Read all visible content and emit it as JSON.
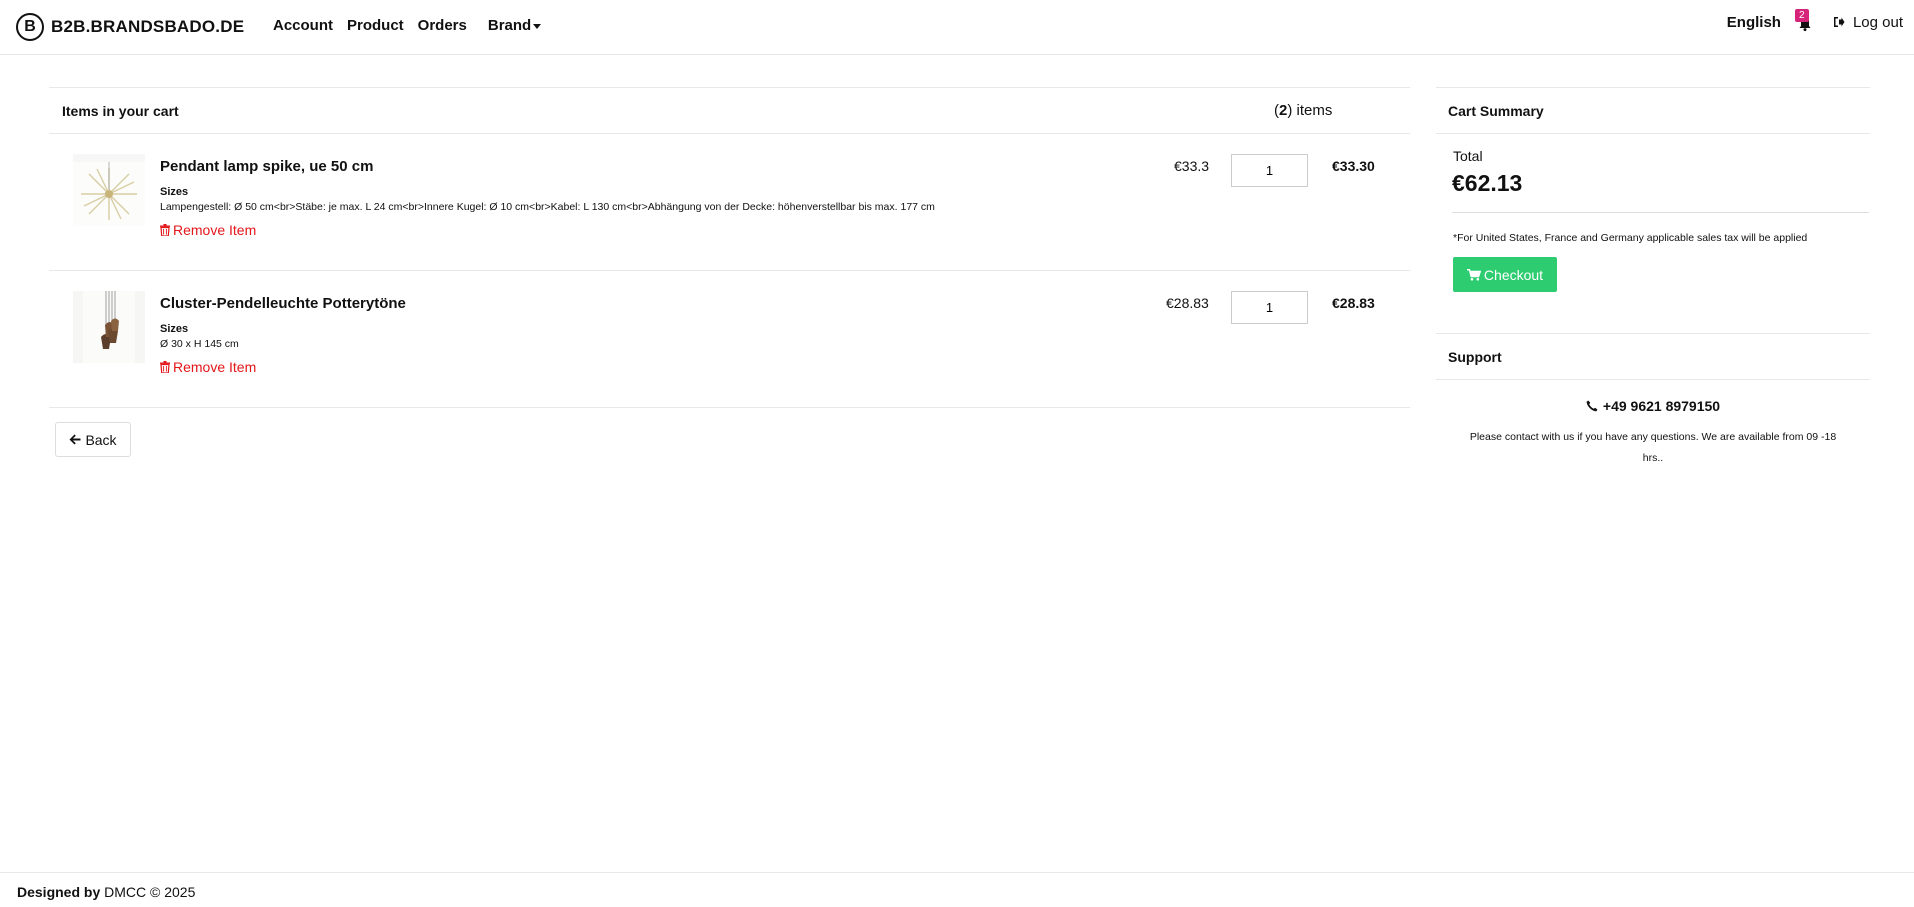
{
  "nav": {
    "brand_letter": "B",
    "brand_name": "B2B.BRANDSBADO.DE",
    "links": [
      "Account",
      "Product",
      "Orders"
    ],
    "brand_menu": "Brand",
    "language": "English",
    "notification_count": "2",
    "logout": "Log out"
  },
  "cart": {
    "title": "Items in your cart",
    "count": "2",
    "count_suffix": " items",
    "items": [
      {
        "name": "Pendant lamp spike, ue 50 cm",
        "sizes_label": "Sizes",
        "sizes_value": "Lampengestell: Ø 50 cm<br>Stäbe: je max. L 24 cm<br>Innere Kugel: Ø 10 cm<br>Kabel: L 130 cm<br>Abhängung von der Decke: höhenverstellbar bis max. 177 cm",
        "remove": "Remove Item",
        "unit_price": "€33.3",
        "quantity": "1",
        "line_total": "€33.30",
        "thumb_icon": "spike-lamp-image"
      },
      {
        "name": "Cluster-Pendelleuchte Potterytöne",
        "sizes_label": "Sizes",
        "sizes_value": "Ø 30 x H 145 cm",
        "remove": "Remove Item",
        "unit_price": "€28.83",
        "quantity": "1",
        "line_total": "€28.83",
        "thumb_icon": "cluster-lamp-image"
      }
    ],
    "back": "Back"
  },
  "summary": {
    "title": "Cart Summary",
    "total_label": "Total",
    "total_value": "€62.13",
    "tax_note": "*For United States, France and Germany applicable sales tax will be applied",
    "checkout": "Checkout",
    "support_title": "Support",
    "phone": "+49 9621 8979150",
    "support_text": "Please contact with us if you have any questions. We are available from 09 -18 hrs.."
  },
  "footer": {
    "designed_by": "Designed by",
    "credit": " DMCC © 2025"
  },
  "colors": {
    "checkout": "#2ecc71",
    "remove": "#e3161a",
    "badge": "#d6247a"
  }
}
